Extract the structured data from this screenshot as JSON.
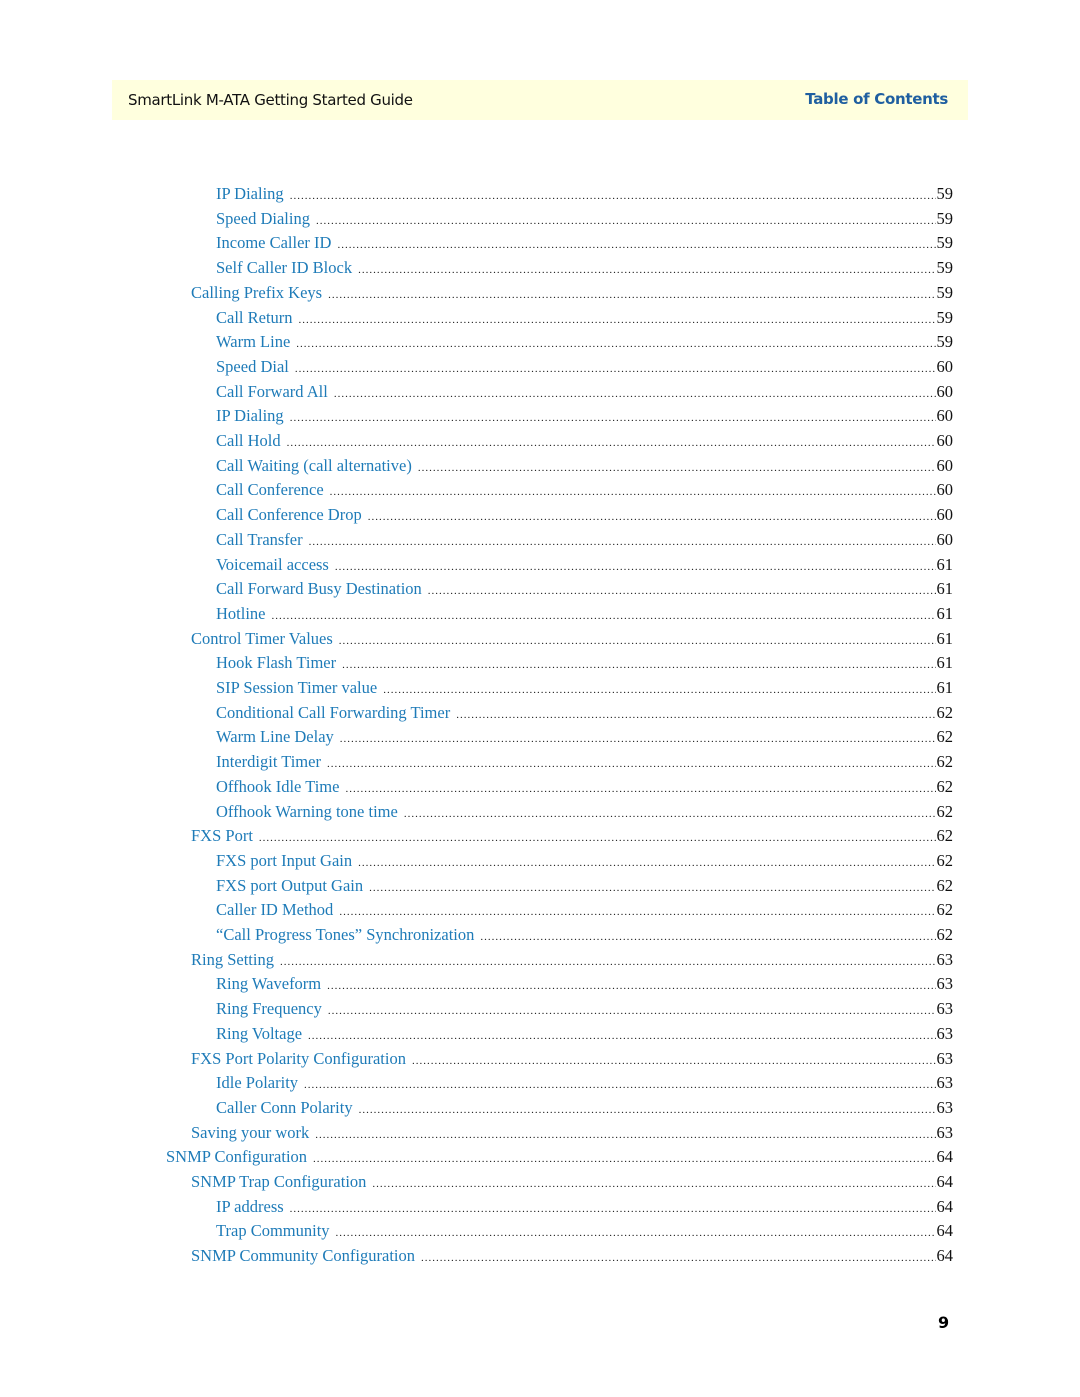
{
  "header": {
    "title": "SmartLink M-ATA Getting Started Guide",
    "section": "Table of Contents"
  },
  "toc": [
    {
      "label": "IP Dialing",
      "page": "59",
      "level": 3
    },
    {
      "label": "Speed Dialing",
      "page": "59",
      "level": 3
    },
    {
      "label": "Income Caller ID",
      "page": "59",
      "level": 3
    },
    {
      "label": "Self Caller ID Block",
      "page": "59",
      "level": 3
    },
    {
      "label": "Calling Prefix Keys",
      "page": "59",
      "level": 2
    },
    {
      "label": "Call Return",
      "page": "59",
      "level": 3
    },
    {
      "label": "Warm Line",
      "page": "59",
      "level": 3
    },
    {
      "label": "Speed Dial",
      "page": "60",
      "level": 3
    },
    {
      "label": "Call Forward All",
      "page": "60",
      "level": 3
    },
    {
      "label": "IP Dialing",
      "page": "60",
      "level": 3
    },
    {
      "label": "Call Hold",
      "page": "60",
      "level": 3
    },
    {
      "label": "Call Waiting (call alternative)",
      "page": "60",
      "level": 3
    },
    {
      "label": "Call Conference",
      "page": "60",
      "level": 3
    },
    {
      "label": "Call Conference Drop",
      "page": "60",
      "level": 3
    },
    {
      "label": "Call Transfer",
      "page": "60",
      "level": 3
    },
    {
      "label": "Voicemail access",
      "page": "61",
      "level": 3
    },
    {
      "label": "Call Forward Busy Destination",
      "page": "61",
      "level": 3
    },
    {
      "label": "Hotline",
      "page": "61",
      "level": 3
    },
    {
      "label": "Control Timer Values",
      "page": "61",
      "level": 2
    },
    {
      "label": "Hook Flash Timer",
      "page": "61",
      "level": 3
    },
    {
      "label": "SIP Session Timer value",
      "page": "61",
      "level": 3
    },
    {
      "label": "Conditional Call Forwarding Timer",
      "page": "62",
      "level": 3
    },
    {
      "label": "Warm Line Delay",
      "page": "62",
      "level": 3
    },
    {
      "label": "Interdigit Timer",
      "page": "62",
      "level": 3
    },
    {
      "label": "Offhook Idle Time",
      "page": "62",
      "level": 3
    },
    {
      "label": "Offhook Warning tone time",
      "page": "62",
      "level": 3
    },
    {
      "label": "FXS Port",
      "page": "62",
      "level": 2
    },
    {
      "label": "FXS port Input Gain",
      "page": "62",
      "level": 3
    },
    {
      "label": "FXS port Output Gain",
      "page": "62",
      "level": 3
    },
    {
      "label": "Caller ID Method",
      "page": "62",
      "level": 3
    },
    {
      "label": "“Call Progress Tones” Synchronization",
      "page": "62",
      "level": 3
    },
    {
      "label": "Ring Setting",
      "page": "63",
      "level": 2
    },
    {
      "label": "Ring Waveform",
      "page": "63",
      "level": 3
    },
    {
      "label": "Ring Frequency",
      "page": "63",
      "level": 3
    },
    {
      "label": "Ring Voltage",
      "page": "63",
      "level": 3
    },
    {
      "label": "FXS Port Polarity Configuration",
      "page": "63",
      "level": 2
    },
    {
      "label": "Idle Polarity",
      "page": "63",
      "level": 3
    },
    {
      "label": "Caller Conn Polarity",
      "page": "63",
      "level": 3
    },
    {
      "label": "Saving your work",
      "page": "63",
      "level": 2
    },
    {
      "label": "SNMP Configuration",
      "page": "64",
      "level": 1
    },
    {
      "label": "SNMP Trap Configuration",
      "page": "64",
      "level": 2
    },
    {
      "label": "IP address",
      "page": "64",
      "level": 3
    },
    {
      "label": "Trap Community",
      "page": "64",
      "level": 3
    },
    {
      "label": "SNMP Community Configuration",
      "page": "64",
      "level": 2
    }
  ],
  "footer": {
    "page_number": "9"
  }
}
